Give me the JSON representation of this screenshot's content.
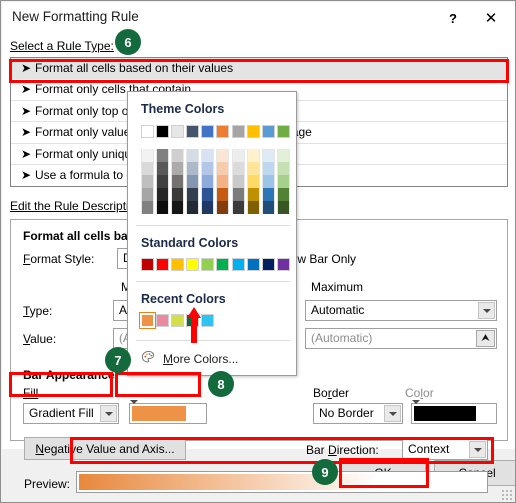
{
  "window": {
    "title": "New Formatting Rule",
    "help_button": "?",
    "close_button": "✕"
  },
  "rule_type": {
    "section_label": "Select a Rule Type:",
    "items": [
      {
        "label": "Format all cells based on their values",
        "selected": true
      },
      {
        "label": "Format only cells that contain",
        "selected": false
      },
      {
        "label": "Format only top or bottom ranked values",
        "selected": false
      },
      {
        "label": "Format only values that are above or below average",
        "selected": false
      },
      {
        "label": "Format only unique or duplicate values",
        "selected": false
      },
      {
        "label": "Use a formula to determine which cells to format",
        "selected": false
      }
    ]
  },
  "rule_description": {
    "section_label": "Edit the Rule Description:",
    "heading": "Format all cells based on their values:",
    "format_style_label": "Format Style:",
    "format_style_value": "Data Bar",
    "show_bar_only_label": "Show Bar Only",
    "show_bar_only_checked": false,
    "minimum_header": "Minimum",
    "maximum_header": "Maximum",
    "type_label": "Type:",
    "type_min_value": "Automatic",
    "type_max_value": "Automatic",
    "value_label": "Value:",
    "value_min_value": "(Automatic)",
    "value_max_value": "(Automatic)",
    "bar_appearance_label": "Bar Appearance:",
    "fill_label": "Fill",
    "fill_value": "Gradient Fill",
    "fill_color": "#ED9247",
    "border_label": "Border",
    "border_value": "No Border",
    "color_label": "Color",
    "border_color": "#000000",
    "negative_button": "Negative Value and Axis...",
    "bar_direction_label": "Bar Direction:",
    "bar_direction_value": "Context",
    "preview_label": "Preview:",
    "preview_gradient_from": "#E8883C",
    "preview_gradient_to": "#FFFFFF"
  },
  "color_panel": {
    "theme_colors_title": "Theme Colors",
    "standard_colors_title": "Standard Colors",
    "recent_colors_title": "Recent Colors",
    "more_colors_label": "More Colors...",
    "more_colors_icon": "palette-icon",
    "theme_base": [
      "#FFFFFF",
      "#000000",
      "#E7E6E6",
      "#44546A",
      "#4472C4",
      "#ED7D31",
      "#A5A5A5",
      "#FFC000",
      "#5B9BD5",
      "#70AD47"
    ],
    "theme_variants": [
      [
        "#F2F2F2",
        "#D9D9D9",
        "#BFBFBF",
        "#A6A6A6",
        "#808080"
      ],
      [
        "#808080",
        "#595959",
        "#404040",
        "#262626",
        "#0D0D0D"
      ],
      [
        "#D0CECE",
        "#AEAAAA",
        "#767171",
        "#3B3838",
        "#161616"
      ],
      [
        "#D6DCE4",
        "#ACB9CA",
        "#8496B0",
        "#333F4F",
        "#222A35"
      ],
      [
        "#D9E2F3",
        "#B4C6E7",
        "#8EAADB",
        "#2F5496",
        "#1F3864"
      ],
      [
        "#FBE5D5",
        "#F7CBAC",
        "#F4B183",
        "#C55A11",
        "#833C0B"
      ],
      [
        "#EDEDED",
        "#DBDBDB",
        "#C9C9C9",
        "#7B7B7B",
        "#3B3B3B"
      ],
      [
        "#FFF2CC",
        "#FFE599",
        "#FFD966",
        "#BF9000",
        "#7F6000"
      ],
      [
        "#DEEAF6",
        "#BDD7EE",
        "#9DC3E6",
        "#2E75B6",
        "#1F4E79"
      ],
      [
        "#E2EFD9",
        "#C5E0B3",
        "#A8D08D",
        "#538135",
        "#375623"
      ]
    ],
    "standard_colors": [
      "#C00000",
      "#FF0000",
      "#FFC000",
      "#FFFF00",
      "#92D050",
      "#00B050",
      "#00B0F0",
      "#0070C0",
      "#002060",
      "#7030A0"
    ],
    "recent_colors": [
      "#ED9247",
      "#EA8AA0",
      "#D2DE4C",
      "#12693E",
      "#2EC4F0"
    ],
    "recent_selected_index": 0
  },
  "footer": {
    "ok_label": "OK",
    "cancel_label": "Cancel"
  },
  "annotations": {
    "badges": [
      "6",
      "7",
      "8",
      "9"
    ]
  }
}
